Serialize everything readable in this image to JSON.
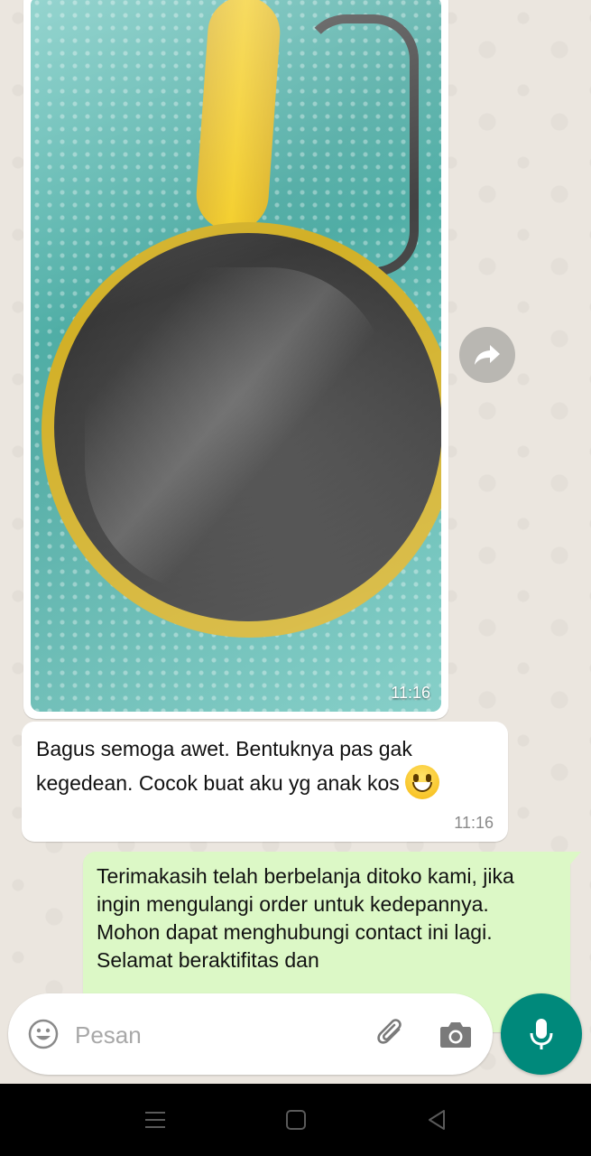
{
  "messages": {
    "image_message": {
      "time": "11:16"
    },
    "review_message": {
      "text": "Bagus semoga awet. Bentuknya pas gak kegedean. Cocok buat aku yg anak kos",
      "time": "11:16"
    },
    "reply_message": {
      "text": "Terimakasih telah berbelanja ditoko kami, jika ingin mengulangi order untuk kedepannya. Mohon dapat menghubungi contact ini lagi. Selamat beraktifitas dan"
    }
  },
  "composer": {
    "placeholder": "Pesan"
  },
  "icons": {
    "forward": "forward-icon",
    "emoji": "emoji-icon",
    "attach": "paperclip-icon",
    "camera": "camera-icon",
    "mic": "microphone-icon",
    "nav_menu": "menu-icon",
    "nav_home": "home-icon",
    "nav_back": "back-icon"
  },
  "colors": {
    "outgoing_bubble": "#dcf8c6",
    "incoming_bubble": "#ffffff",
    "mic_button": "#00897b",
    "chat_background": "#ebe6df"
  }
}
